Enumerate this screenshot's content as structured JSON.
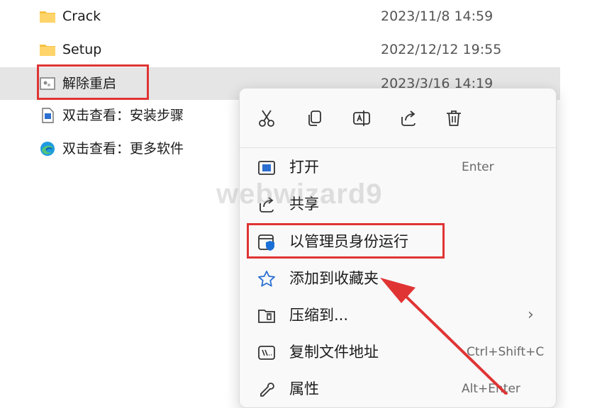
{
  "files": [
    {
      "name": "Crack",
      "date": "2023/11/8 14:59",
      "icon": "folder-icon"
    },
    {
      "name": "Setup",
      "date": "2022/12/12 19:55",
      "icon": "folder-icon"
    },
    {
      "name": "解除重启",
      "date": "2023/3/16 14:19",
      "icon": "registry-file-icon"
    },
    {
      "name": "双击查看：安装步骤",
      "date": "",
      "icon": "web-shortcut-icon"
    },
    {
      "name": "双击查看：更多软件",
      "date": "",
      "icon": "edge-icon"
    }
  ],
  "context_menu": {
    "toolbar": [
      "cut-icon",
      "copy-icon",
      "rename-icon",
      "share-icon",
      "delete-icon"
    ],
    "items": [
      {
        "label": "打开",
        "shortcut": "Enter",
        "icon": "open-icon"
      },
      {
        "label": "共享",
        "shortcut": "",
        "icon": "share-icon"
      },
      {
        "label": "以管理员身份运行",
        "shortcut": "",
        "icon": "run-as-admin-icon"
      },
      {
        "label": "添加到收藏夹",
        "shortcut": "",
        "icon": "star-icon"
      },
      {
        "label": "压缩到...",
        "shortcut": "",
        "icon": "zip-icon"
      },
      {
        "label": "复制文件地址",
        "shortcut": "Ctrl+Shift+C",
        "icon": "copy-path-icon"
      },
      {
        "label": "属性",
        "shortcut": "Alt+Enter",
        "icon": "properties-icon"
      }
    ],
    "submenu_arrow": "›"
  },
  "watermark": "webwizard9",
  "colors": {
    "highlight": "#e03434",
    "folder": "#f5c242",
    "selected_row": "#e5e5e5",
    "admin_shield": "#1a6fd6"
  }
}
